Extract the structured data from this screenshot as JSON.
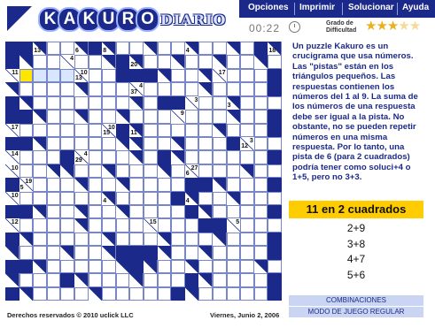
{
  "header": {
    "logo_letters": [
      "K",
      "A",
      "K",
      "U",
      "R",
      "O"
    ],
    "logo_sub": "DIARIO",
    "menu": [
      "Opciones",
      "Imprimir",
      "Solucionar",
      "Ayuda"
    ],
    "timer": "00:22",
    "grade_label": "Grado de Difficultad",
    "stars_filled": 3,
    "stars_total": 5
  },
  "sidebar": {
    "instructions": "Un puzzle Kakuro es un crucigrama que usa números. Las \"pistas\" están en los triángulos pequeños. Las respuestas contienen los números del 1 al 9. La suma de los números de una respuesta debe ser igual a la pista. No obstante, no se pueden repetir números en una misma respuesta. Por lo tanto, una pista de 6 (para 2 cuadrados) podría tener como soluci+4 o 1+5, pero no 3+3.",
    "hint_title": "11 en 2 cuadrados",
    "combos": [
      "2+9",
      "3+8",
      "4+7",
      "5+6"
    ],
    "btn_combinations": "COMBINACIONES",
    "btn_mode": "MODO DE JUEGO REGULAR"
  },
  "footer": {
    "copyright": "Derechos reservados © 2010 uclick LLC",
    "date": "Viernes, Junio 2, 2006"
  },
  "board": {
    "rows": 19,
    "cols": 20,
    "layout": [
      "BBCWWCBCWWCWWCWWCWBC",
      "BCWWCWWCBCWWCWWCWWCW",
      "CWWWWCWWBBBCWWCCWWWB",
      "CWWWWCWWWCWWWWCWWWWB",
      "BCWWWWWWWCWBBCWWCWWW",
      "BBCWWCWWCWWWCWWWCWWB",
      "CWWWWWWCBCWWWWWCWWWB",
      "BBCWWWWWCCWWCWWWBCWW",
      "CWWWBCWWWCWBCWWWWWWB",
      "CWWCCWWCWWWCWCWWWCWW",
      "BCWWWCWWCWWWWBBCWWWB",
      "CWWWWWWCWWWWBCWWCWWW",
      "BBCWWCWWCWWWWBCWWWWB",
      "CWWWWCWWWWCWWWBBCWWW",
      "BCWWWWWCWWWCWWWCWWWB",
      "CWWWCWWCBBBCWWCWWWWB",
      "BBCWWWWWCBCWWCWWWWCW",
      "CWWWBCWWWCWWWBCWWWWB",
      "BCWWWWCWWWWWBCWWWWWB"
    ],
    "clues": {
      "0,2": {
        "d": "13"
      },
      "0,3": {
        "d": "9"
      },
      "0,5": {
        "d": "6"
      },
      "0,6": {
        "d": "23"
      },
      "0,7": {
        "d": "8"
      },
      "0,11": {
        "d": "8"
      },
      "0,13": {
        "d": "4"
      },
      "0,15": {
        "d": "10"
      },
      "0,17": {
        "d": "23"
      },
      "0,19": {
        "d": "18"
      },
      "1,0": {
        "r": "5"
      },
      "1,4": {
        "r": "4"
      },
      "1,8": {
        "r": "6"
      },
      "1,9": {
        "d": "20"
      },
      "1,13": {
        "r": "10"
      },
      "2,0": {
        "r": "11"
      },
      "2,5": {
        "r": "10",
        "d": "13"
      },
      "2,10": {
        "r": "13"
      },
      "2,15": {
        "r": "17"
      },
      "3,1": {
        "r": "16"
      },
      "3,7": {
        "d": "7"
      },
      "3,9": {
        "r": "4",
        "d": "37"
      },
      "3,15": {
        "r": "4"
      },
      "4,2": {
        "r": "17",
        "d": "9"
      },
      "4,8": {
        "r": "14"
      },
      "4,13": {
        "r": "3"
      },
      "4,16": {
        "d": "3"
      },
      "5,0": {
        "r": "10"
      },
      "5,9": {
        "r": "13"
      },
      "5,12": {
        "r": "9"
      },
      "6,0": {
        "r": "17"
      },
      "6,7": {
        "r": "10",
        "d": "15"
      },
      "6,9": {
        "d": "11"
      },
      "6,16": {
        "r": "8"
      },
      "7,6": {
        "r": "34",
        "d": "12"
      },
      "7,1": {
        "d": "11"
      },
      "7,3": {
        "d": "22"
      },
      "7,17": {
        "r": "3",
        "d": "12"
      },
      "8,0": {
        "r": "14"
      },
      "8,5": {
        "d": "29",
        "r": "4"
      },
      "8,11": {
        "r": "19"
      },
      "8,15": {
        "r": "11",
        "d": "15"
      },
      "9,0": {
        "r": "10"
      },
      "9,8": {
        "d": "9",
        "r": "10"
      },
      "9,13": {
        "r": "27",
        "d": "6"
      },
      "10,1": {
        "r": "19",
        "d": "5"
      },
      "10,6": {
        "r": "6",
        "d": "24"
      },
      "10,11": {
        "r": "10",
        "d": "16"
      },
      "10,17": {
        "r": "13"
      },
      "11,0": {
        "r": "10"
      },
      "11,5": {
        "d": "4"
      },
      "11,7": {
        "d": "4"
      },
      "11,13": {
        "d": "4"
      },
      "11,18": {
        "r": "9"
      },
      "12,0": {
        "r": "8"
      },
      "12,4": {
        "r": "6"
      },
      "12,10": {
        "r": "10"
      },
      "12,15": {
        "r": "4"
      },
      "13,0": {
        "r": "12"
      },
      "13,4": {
        "r": "3"
      },
      "13,10": {
        "r": "15"
      },
      "13,16": {
        "r": "5"
      }
    },
    "selected": "2,1",
    "highlighted": [
      "2,2",
      "2,3",
      "2,4"
    ]
  }
}
